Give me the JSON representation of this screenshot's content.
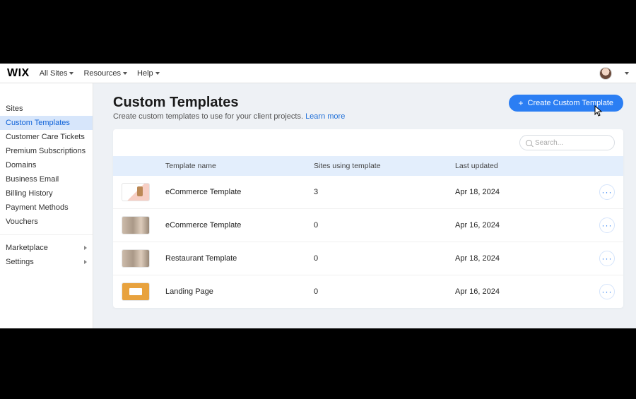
{
  "topbar": {
    "logo": "WIX",
    "items": [
      "All Sites",
      "Resources",
      "Help"
    ]
  },
  "sidebar": {
    "items": [
      {
        "label": "Sites"
      },
      {
        "label": "Custom Templates",
        "active": true
      },
      {
        "label": "Customer Care Tickets"
      },
      {
        "label": "Premium Subscriptions"
      },
      {
        "label": "Domains"
      },
      {
        "label": "Business Email"
      },
      {
        "label": "Billing History"
      },
      {
        "label": "Payment Methods"
      },
      {
        "label": "Vouchers"
      }
    ],
    "footer": [
      {
        "label": "Marketplace"
      },
      {
        "label": "Settings"
      }
    ]
  },
  "page": {
    "title": "Custom Templates",
    "subtitle": "Create custom templates to use for your client projects. ",
    "learn": "Learn more",
    "create_btn": "Create Custom Template",
    "search_placeholder": "Search..."
  },
  "table": {
    "headers": {
      "name": "Template name",
      "sites": "Sites using template",
      "updated": "Last updated"
    },
    "rows": [
      {
        "thumb": "t1",
        "name": "eCommerce Template",
        "sites": "3",
        "updated": "Apr 18, 2024"
      },
      {
        "thumb": "t2",
        "name": "eCommerce Template",
        "sites": "0",
        "updated": "Apr 16, 2024"
      },
      {
        "thumb": "t2",
        "name": "Restaurant Template",
        "sites": "0",
        "updated": "Apr 18, 2024"
      },
      {
        "thumb": "t3",
        "name": "Landing Page",
        "sites": "0",
        "updated": "Apr 16, 2024"
      }
    ]
  }
}
